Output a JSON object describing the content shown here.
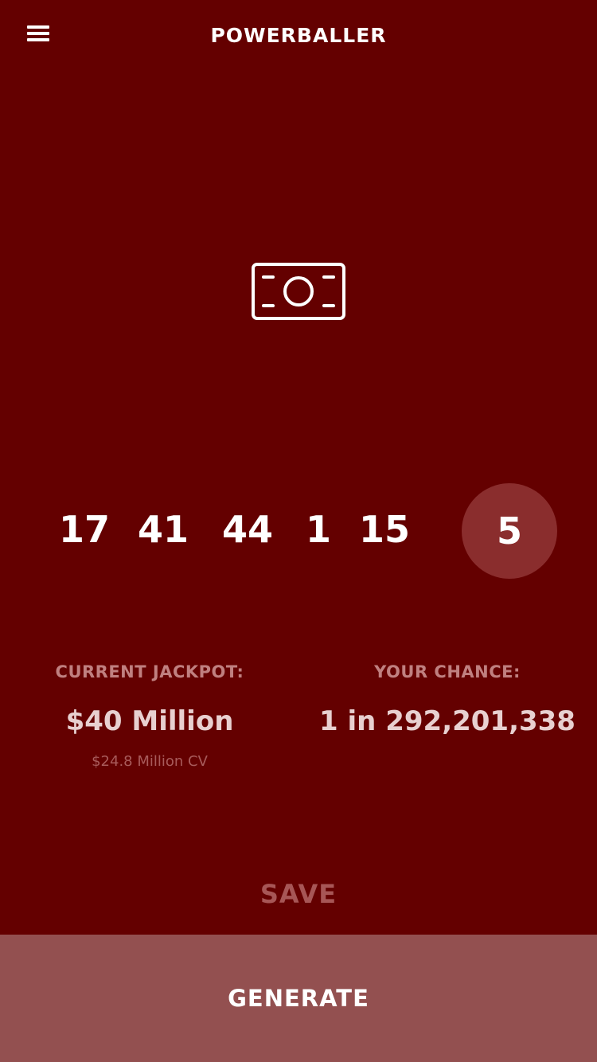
{
  "header": {
    "title": "POWERBALLER",
    "menu_icon": "hamburger-menu-icon"
  },
  "hero": {
    "icon": "money-bill-icon"
  },
  "numbers": {
    "white_balls": [
      "17",
      "41",
      "44",
      "1",
      "15"
    ],
    "powerball": "5"
  },
  "jackpot": {
    "label": "CURRENT JACKPOT:",
    "value": "$40 Million",
    "cash_value": "$24.8 Million CV"
  },
  "chance": {
    "label": "YOUR CHANCE:",
    "value": "1 in 292,201,338"
  },
  "actions": {
    "save_label": "SAVE",
    "generate_label": "GENERATE"
  },
  "colors": {
    "background": "#640000",
    "powerball_circle": "#8a2d2d",
    "generate_bar": "#935050",
    "muted_text": "#c08080"
  }
}
